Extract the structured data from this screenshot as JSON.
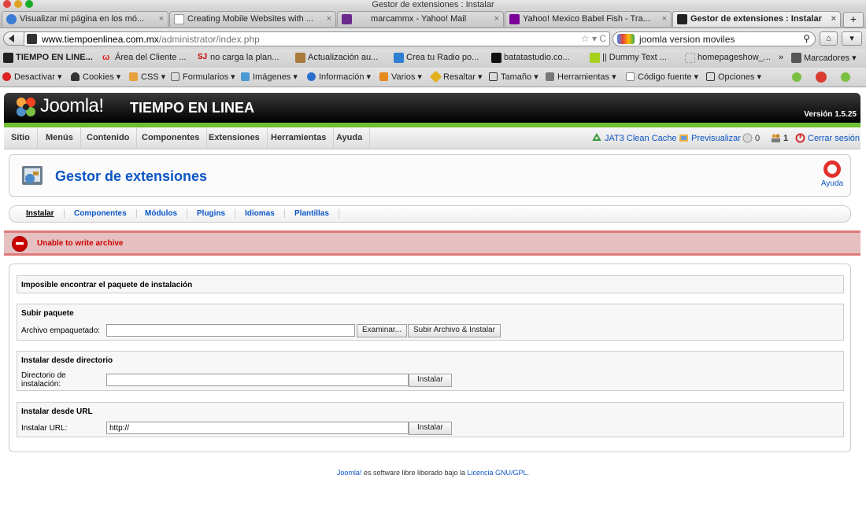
{
  "window": {
    "title": "Gestor de extensiones : Instalar"
  },
  "tabs": [
    {
      "label": "Visualizar mi página en los mó...",
      "close": "×"
    },
    {
      "label": "Creating Mobile Websites with ...",
      "close": "×"
    },
    {
      "label": "marcammx - Yahoo! Mail",
      "close": "×"
    },
    {
      "label": "Yahoo! Mexico Babel Fish - Tra...",
      "close": "×"
    },
    {
      "label": "Gestor de extensiones : Instalar",
      "close": "×"
    }
  ],
  "new_tab": "+",
  "navbar": {
    "url_domain": "www.tiempoenlinea.com.mx",
    "url_path": "/administrator/index.php",
    "url_tools": "☆ ▾ C",
    "search_value": "joomla version moviles",
    "home": "⌂"
  },
  "bookmarks": [
    "TIEMPO EN LINE...",
    "Área del Cliente ...",
    "no carga la plan...",
    "Actualización au...",
    "Crea tu Radio po...",
    "batatastudio.co...",
    "|| Dummy Text ...",
    "homepageshow_...",
    "»",
    "Marcadores ▾"
  ],
  "devbar": [
    "Desactivar ▾",
    "Cookies ▾",
    "CSS ▾",
    "Formularios ▾",
    "Imágenes ▾",
    "Información ▾",
    "Varios ▾",
    "Resaltar ▾",
    "Tamaño ▾",
    "Herramientas ▾",
    "Código fuente ▾",
    "Opciones ▾"
  ],
  "joomla": {
    "brand": "Joomla!",
    "site_name": "TIEMPO EN LINEA",
    "version": "Versión 1.5.25"
  },
  "menu": [
    "Sitio",
    "Menús",
    "Contenido",
    "Componentes",
    "Extensiones",
    "Herramientas",
    "Ayuda"
  ],
  "menu_right": {
    "cache": "JAT3 Clean Cache",
    "preview": "Previsualizar",
    "messages": "0",
    "users": "1",
    "logout": "Cerrar sesión"
  },
  "page": {
    "title": "Gestor de extensiones",
    "help": "Ayuda"
  },
  "subnav": [
    "Instalar",
    "Componentes",
    "Módulos",
    "Plugins",
    "Idiomas",
    "Plantillas"
  ],
  "error": "Unable to write archive",
  "notice": "Imposible encontrar el paquete de instalación",
  "upload": {
    "legend": "Subir paquete",
    "label": "Archivo empaquetado:",
    "browse": "Examinar...",
    "submit": "Subir Archivo & Instalar"
  },
  "directory": {
    "legend": "Instalar desde directorio",
    "label_line1": "Directorio de",
    "label_line2": "instalación:",
    "value": "",
    "submit": "Instalar"
  },
  "url_install": {
    "legend": "Instalar desde URL",
    "label": "Instalar URL:",
    "value": "http://",
    "submit": "Instalar"
  },
  "footer": {
    "link1": "Joomla!",
    "text": " es software libre liberado bajo la ",
    "link2": "Licencia GNU/GPL",
    "end": "."
  },
  "colors": {
    "joomla_green": "#6fbf30",
    "link_blue": "#0b55c4",
    "error_bg": "#e6c0c0",
    "error_text": "#cc0000"
  }
}
